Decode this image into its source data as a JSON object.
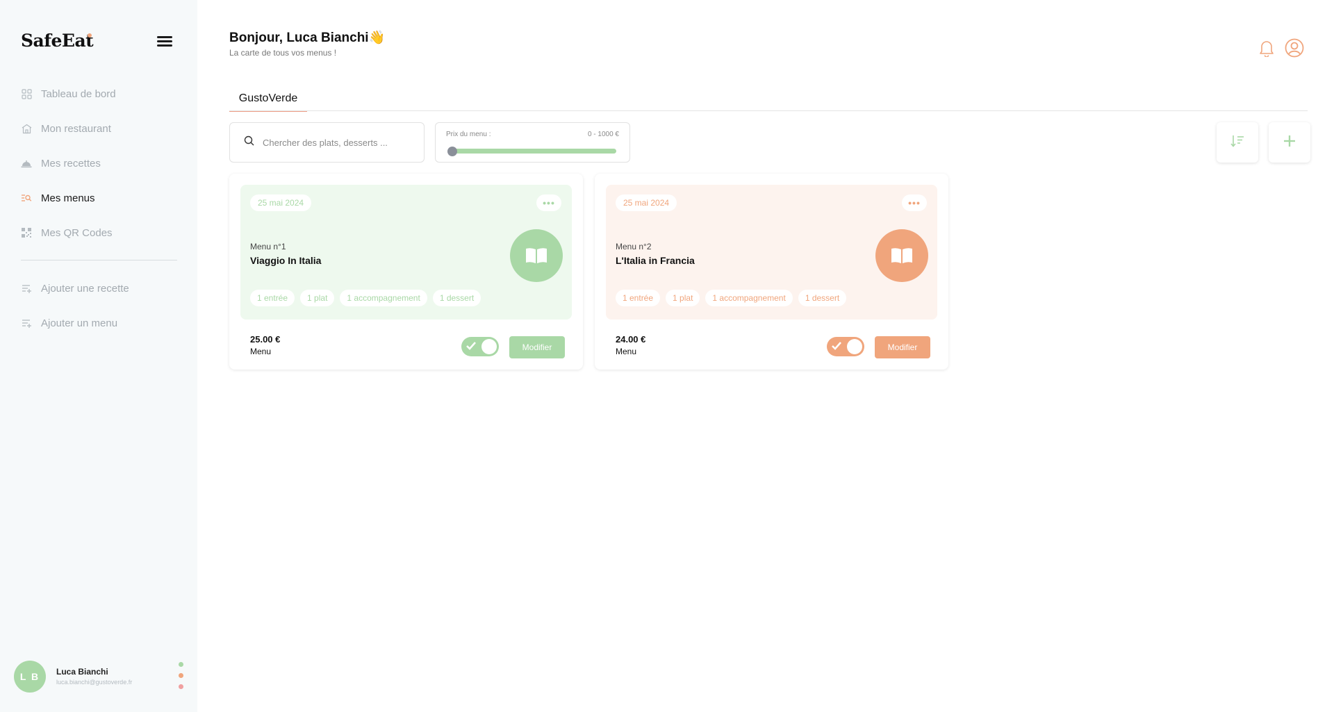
{
  "app": {
    "name": "SafeEat"
  },
  "colors": {
    "green": "#a9d8a6",
    "green_light": "#eef9ee",
    "orange": "#f0a57c",
    "orange_light": "#fdf3ee"
  },
  "sidebar": {
    "items": [
      {
        "label": "Tableau de bord",
        "icon": "dashboard-icon"
      },
      {
        "label": "Mon restaurant",
        "icon": "restaurant-icon"
      },
      {
        "label": "Mes recettes",
        "icon": "cloche-icon"
      },
      {
        "label": "Mes menus",
        "icon": "menu-search-icon",
        "active": true
      },
      {
        "label": "Mes QR Codes",
        "icon": "qr-code-icon"
      }
    ],
    "actions": [
      {
        "label": "Ajouter une recette",
        "icon": "add-list-icon"
      },
      {
        "label": "Ajouter un menu",
        "icon": "add-list-icon"
      }
    ],
    "user": {
      "initials": "L B",
      "name": "Luca Bianchi",
      "email": "luca.bianchi@gustoverde.fr"
    }
  },
  "header": {
    "greeting": "Bonjour, Luca Bianchi👋",
    "subtitle": "La carte de tous vos menus !"
  },
  "tabs": [
    {
      "label": "GustoVerde",
      "active": true
    }
  ],
  "search": {
    "placeholder": "Chercher des plats, desserts ..."
  },
  "price_filter": {
    "label": "Prix du menu :",
    "range": "0 - 1000 €",
    "value_fraction": 0
  },
  "cards": [
    {
      "date": "25 mai 2024",
      "number": "Menu n°1",
      "name": "Viaggio In Italia",
      "tags": [
        "1 entrée",
        "1 plat",
        "1 accompagnement",
        "1 dessert"
      ],
      "price": "25.00 €",
      "unit": "Menu",
      "enabled": true,
      "button": "Modifier",
      "theme": "green"
    },
    {
      "date": "25 mai 2024",
      "number": "Menu n°2",
      "name": "L'Italia in Francia",
      "tags": [
        "1 entrée",
        "1 plat",
        "1 accompagnement",
        "1 dessert"
      ],
      "price": "24.00 €",
      "unit": "Menu",
      "enabled": true,
      "button": "Modifier",
      "theme": "orange"
    }
  ]
}
